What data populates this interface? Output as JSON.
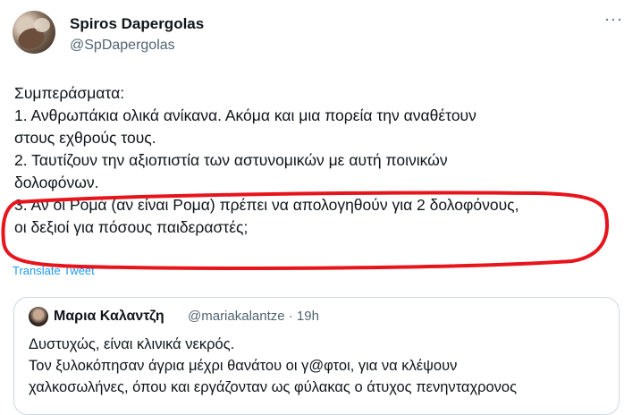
{
  "author": {
    "name": "Spiros Dapergolas",
    "handle": "@SpDapergolas"
  },
  "more_menu": "···",
  "tweet_lines": [
    "Συμπεράσματα:",
    "1. Ανθρωπάκια ολικά ανίκανα. Ακόμα και μια πορεία την αναθέτουν",
    "στους εχθρούς τους.",
    "2. Ταυτίζουν την αξιοπιστία των αστυνομικών με αυτή ποινικών",
    "δολοφόνων.",
    "3. Αν οι Ρομά (αν είναι Ρομα) πρέπει να απολογηθούν για 2 δολοφόνους,",
    "οι δεξιοί για πόσους παιδεραστές;"
  ],
  "translate_label": "Translate Tweet",
  "highlight_color": "#e8141c",
  "link_color": "#1d9bf0",
  "quoted": {
    "name": "Μαρια Καλαντζη",
    "meta": "@mariakalantze · 19h",
    "lines": [
      "Δυστυχώς, είναι κλινικά νεκρός.",
      "Τον ξυλοκόπησαν άγρια μέχρι θανάτου οι γ@φτοι, για να κλέψουν",
      "χαλκοσωλήνες, όπου και εργάζονταν ως φύλακας ο άτυχος πενηνταχρονος"
    ]
  }
}
